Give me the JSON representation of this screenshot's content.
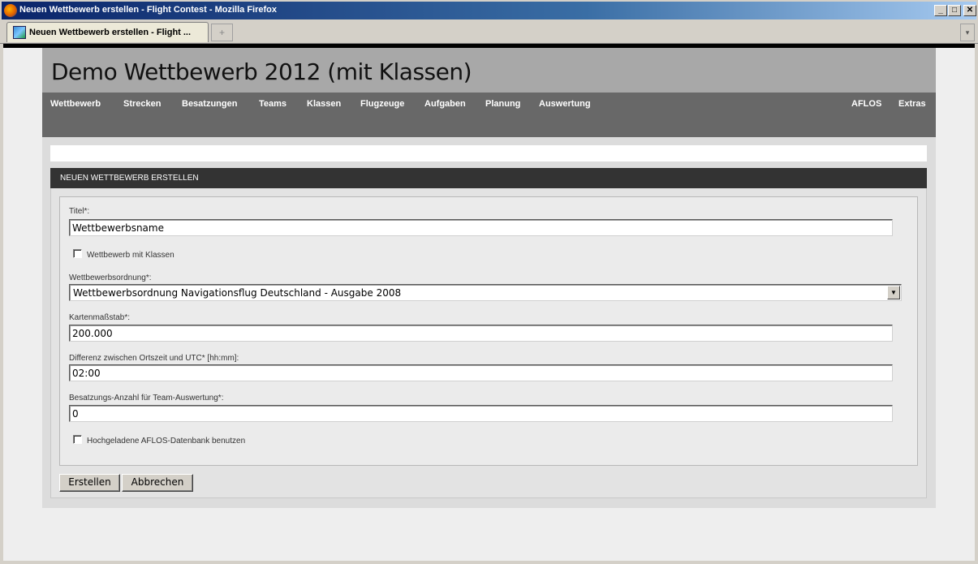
{
  "window": {
    "title": "Neuen Wettbewerb erstellen - Flight Contest - Mozilla Firefox",
    "minimize": "_",
    "maximize": "□",
    "close": "✕"
  },
  "browser": {
    "tab_label": "Neuen Wettbewerb erstellen - Flight ...",
    "new_tab": "+",
    "tab_list": "▾"
  },
  "site": {
    "title": "Demo Wettbewerb 2012 (mit Klassen)"
  },
  "nav": {
    "items": [
      "Wettbewerb",
      "Strecken",
      "Besatzungen",
      "Teams",
      "Klassen",
      "Flugzeuge",
      "Aufgaben",
      "Planung",
      "Auswertung"
    ],
    "right_items": [
      "AFLOS",
      "Extras"
    ]
  },
  "form": {
    "heading": "NEUEN WETTBEWERB ERSTELLEN",
    "title_label": "Titel*:",
    "title_value": "Wettbewerbsname",
    "with_classes_label": "Wettbewerb mit Klassen",
    "with_classes_checked": false,
    "rules_label": "Wettbewerbsordnung*:",
    "rules_value": "Wettbewerbsordnung Navigationsflug Deutschland - Ausgabe 2008",
    "scale_label": "Kartenmaßstab*:",
    "scale_value": "200.000",
    "utc_label": "Differenz zwischen Ortszeit und UTC* [hh:mm]:",
    "utc_value": "02:00",
    "crew_label": "Besatzungs-Anzahl für Team-Auswertung*:",
    "crew_value": "0",
    "aflos_label": "Hochgeladene AFLOS-Datenbank benutzen",
    "aflos_checked": false,
    "create_button": "Erstellen",
    "cancel_button": "Abbrechen"
  }
}
